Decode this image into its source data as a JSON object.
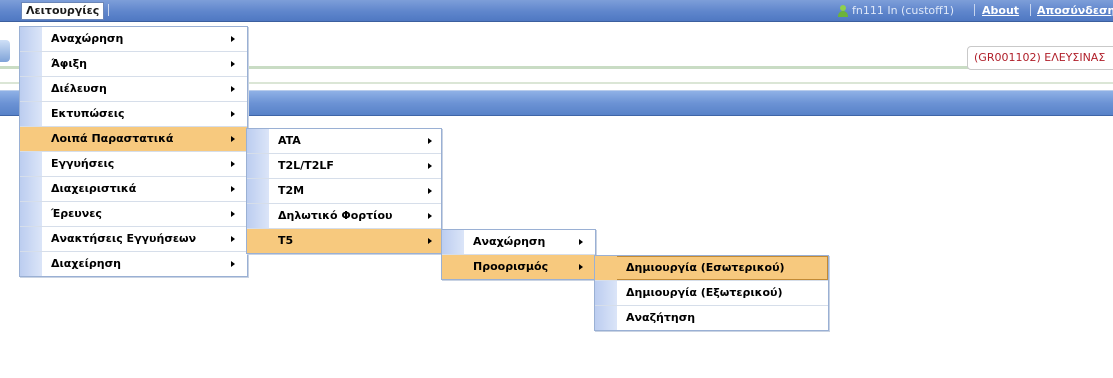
{
  "menubar": {
    "root_menu_label": "Λειτουργίες",
    "user_text": "fn111 In (custoff1)",
    "about_label": "About",
    "logout_label": "Αποσύνδεση"
  },
  "header": {
    "customs_office": "(GR001102) ΕΛΕΥΣΙΝΑΣ"
  },
  "menus": {
    "main": {
      "items": [
        {
          "label": "Αναχώρηση",
          "has_submenu": true
        },
        {
          "label": "Άφιξη",
          "has_submenu": true
        },
        {
          "label": "Διέλευση",
          "has_submenu": true
        },
        {
          "label": "Εκτυπώσεις",
          "has_submenu": true
        },
        {
          "label": "Λοιπά Παραστατικά",
          "has_submenu": true,
          "active": true
        },
        {
          "label": "Εγγυήσεις",
          "has_submenu": true
        },
        {
          "label": "Διαχειριστικά",
          "has_submenu": true
        },
        {
          "label": "Έρευνες",
          "has_submenu": true
        },
        {
          "label": "Ανακτήσεις Εγγυήσεων",
          "has_submenu": true
        },
        {
          "label": "Διαχείρηση",
          "has_submenu": true
        }
      ]
    },
    "other_documents": {
      "items": [
        {
          "label": "ATA",
          "has_submenu": true
        },
        {
          "label": "T2L/T2LF",
          "has_submenu": true
        },
        {
          "label": "T2M",
          "has_submenu": true
        },
        {
          "label": "Δηλωτικό Φορτίου",
          "has_submenu": true
        },
        {
          "label": "T5",
          "has_submenu": true,
          "active": true
        }
      ]
    },
    "t5": {
      "items": [
        {
          "label": "Αναχώρηση",
          "has_submenu": true
        },
        {
          "label": "Προορισμός",
          "has_submenu": true,
          "active": true
        }
      ]
    },
    "destination": {
      "items": [
        {
          "label": "Δημιουργία (Εσωτερικού)",
          "has_submenu": false,
          "active": true
        },
        {
          "label": "Δημιουργία (Εξωτερικού)",
          "has_submenu": false
        },
        {
          "label": "Αναζήτηση",
          "has_submenu": false
        }
      ]
    }
  },
  "colors": {
    "menubar": "#5f86cc",
    "menu_highlight": "#f7c97e",
    "customs_text": "#b01f2a"
  }
}
